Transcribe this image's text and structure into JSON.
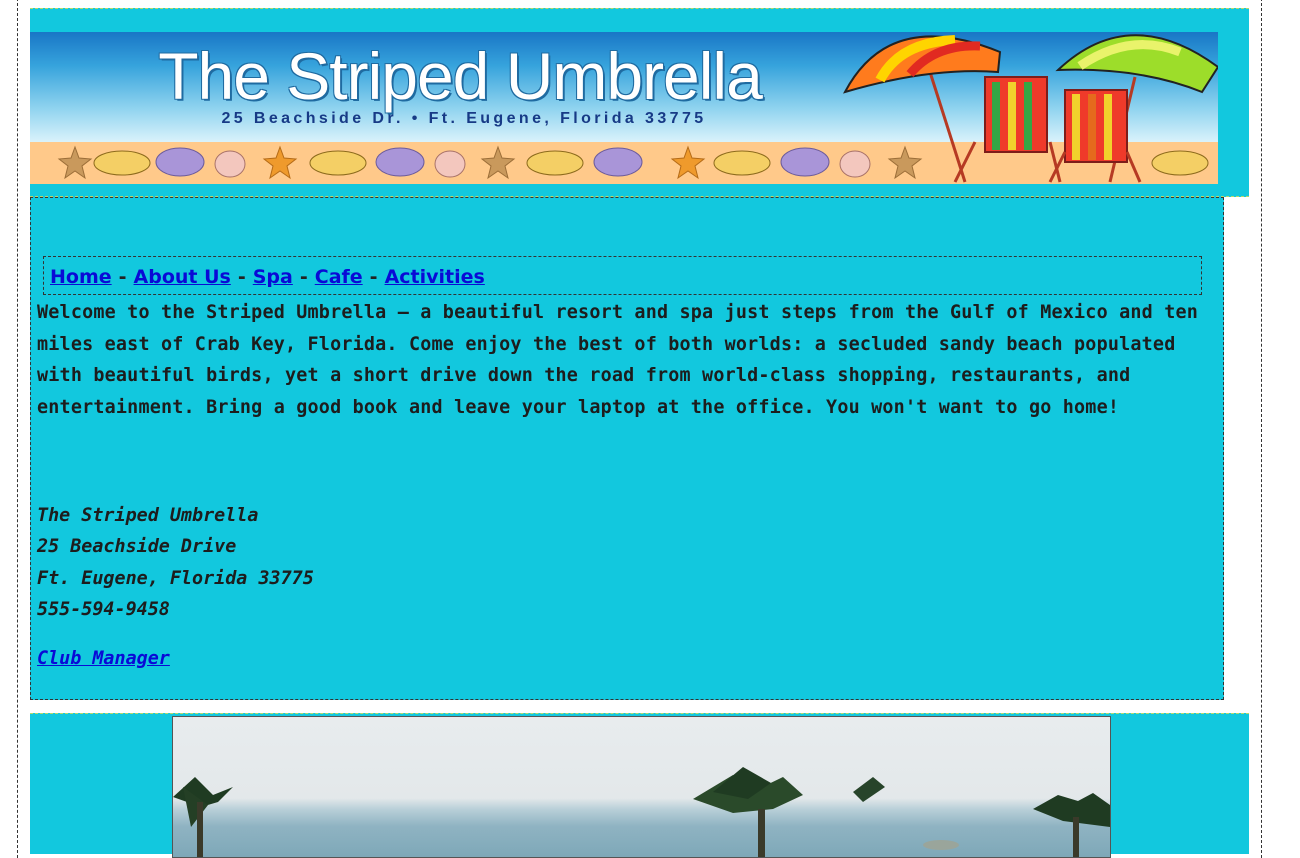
{
  "banner": {
    "title": "The Striped Umbrella",
    "address": "25 Beachside Dr. • Ft. Eugene, Florida 33775"
  },
  "nav": {
    "items": [
      "Home",
      "About Us",
      "Spa",
      "Cafe",
      "Activities"
    ],
    "separator": "-"
  },
  "welcome_text": "Welcome to the Striped Umbrella — a beautiful resort and spa just steps from the Gulf of Mexico and ten miles east of Crab Key, Florida. Come enjoy the best of both worlds: a secluded sandy beach populated with beautiful birds, yet a short drive down the road from world-class shopping, restaurants, and entertainment. Bring a good book and leave your laptop at the office. You won't want to go home!",
  "contact": {
    "name": "The Striped Umbrella",
    "street": "25 Beachside Drive",
    "city": "Ft. Eugene, Florida 33775",
    "phone": "555-594-9458",
    "email_link": "Club Manager"
  },
  "colors": {
    "page_background": "#12c8de",
    "link": "#0a0ad6"
  }
}
